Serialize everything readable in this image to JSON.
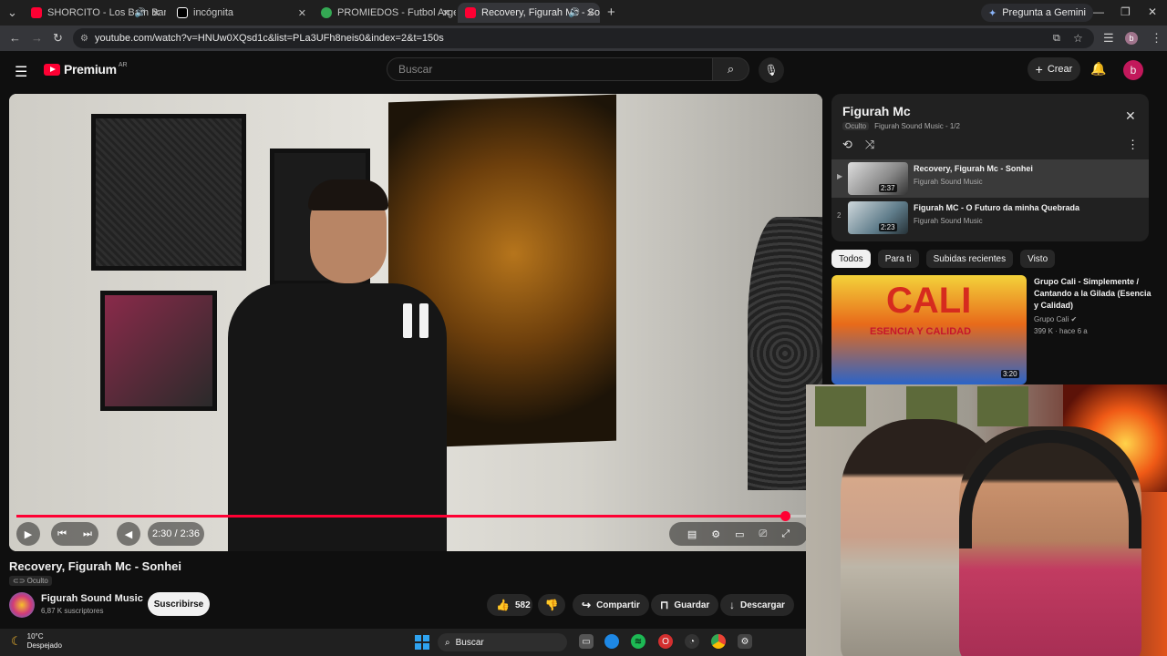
{
  "browser": {
    "tabs": [
      {
        "title": "SHORCITO - Los Bam Band",
        "color": "#ff0033"
      },
      {
        "title": "incógnita",
        "color": "#ffffff"
      },
      {
        "title": "PROMIEDOS - Futbol Argentin",
        "color": "#34a853"
      },
      {
        "title": "Recovery, Figurah Mc - Son",
        "color": "#ff0033"
      }
    ],
    "gemini_label": "Pregunta a Gemini",
    "url": "youtube.com/watch?v=HNUw0XQsd1c&list=PLa3UFh8neis0&index=2&t=150s",
    "profile_initial": "b"
  },
  "youtube": {
    "logo_text": "Premium",
    "country": "AR",
    "search_placeholder": "Buscar",
    "create_label": "Crear",
    "avatar_initial": "b"
  },
  "player": {
    "time": "2:30 / 2:36",
    "progress": 0.962
  },
  "video": {
    "title": "Recovery, Figurah Mc - Sonhei",
    "visibility": "Oculto",
    "channel": "Figurah Sound Music",
    "subscribers": "6,87 K suscriptores",
    "subscribe_label": "Suscribirse",
    "likes": "582",
    "share_label": "Compartir",
    "save_label": "Guardar",
    "download_label": "Descargar"
  },
  "playlist": {
    "title": "Figurah Mc",
    "visibility": "Oculto",
    "owner_position": "Figurah Sound Music - 1/2",
    "items": [
      {
        "index": "▶",
        "title": "Recovery, Figurah Mc - Sonhei",
        "channel": "Figurah Sound Music",
        "duration": "2:37"
      },
      {
        "index": "2",
        "title": "Figurah MC - O Futuro da minha Quebrada",
        "channel": "Figurah Sound Music",
        "duration": "2:23"
      }
    ]
  },
  "chips": [
    "Todos",
    "Para ti",
    "Subidas recientes",
    "Visto"
  ],
  "recommendation": {
    "title": "Grupo Cali - Simplemente / Cantando a la Gilada (Esencia y Calidad)",
    "channel": "Grupo Cali",
    "meta": "399 K · hace 6 a",
    "duration": "3:20",
    "thumb_big": "CALI",
    "thumb_sub": "ESENCIA Y CALIDAD"
  },
  "taskbar": {
    "temp": "10°C",
    "weather": "Despejado",
    "search_label": "Buscar"
  }
}
